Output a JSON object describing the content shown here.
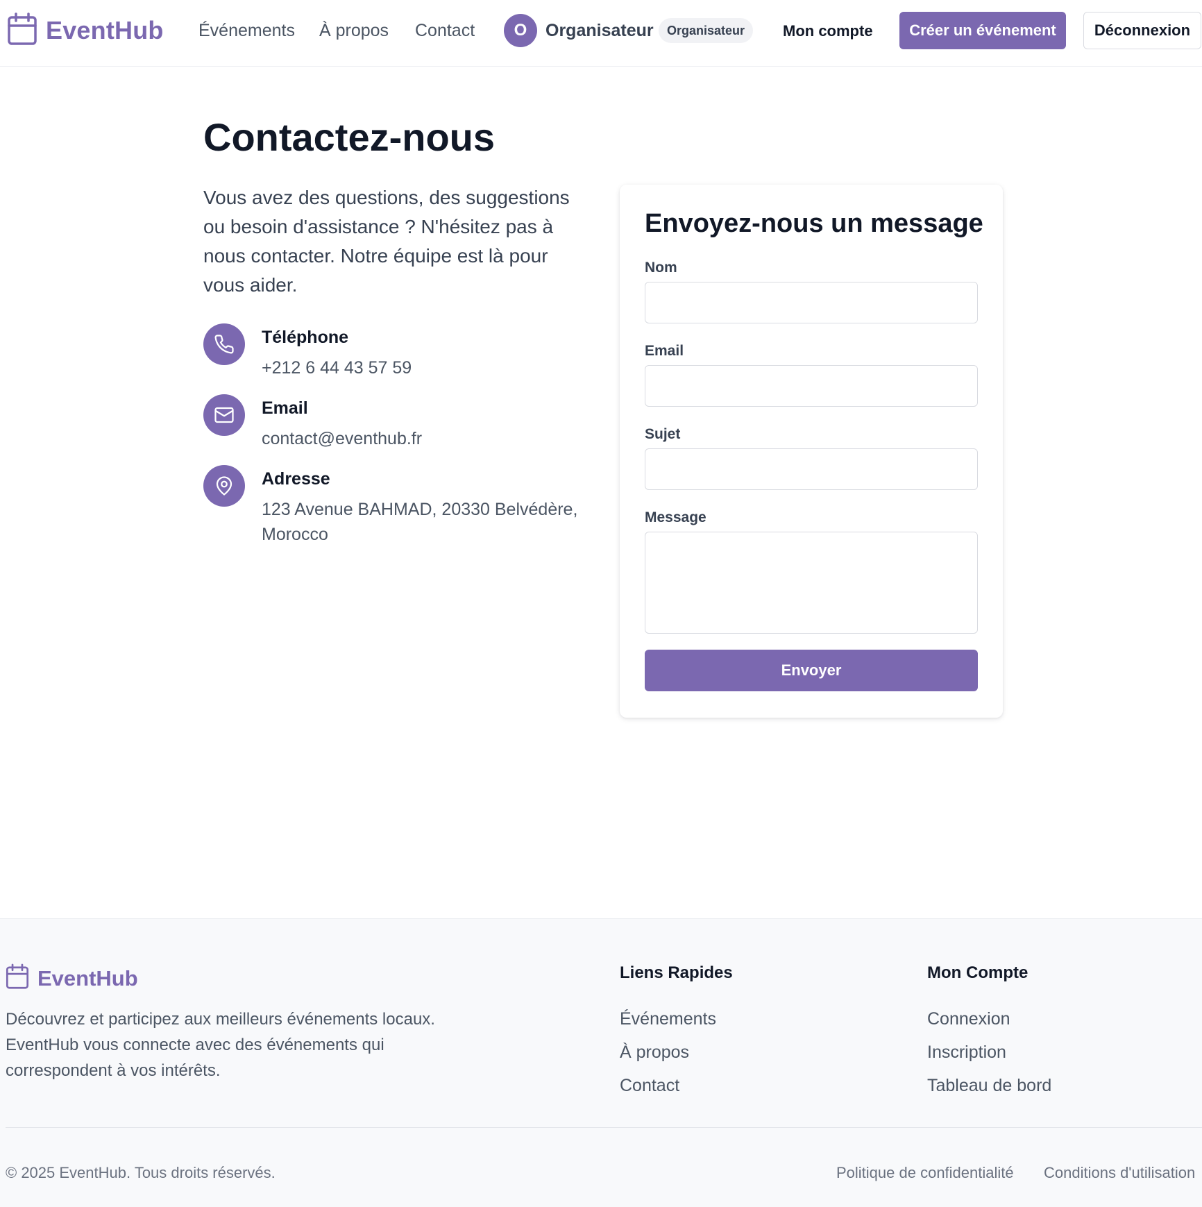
{
  "header": {
    "brand": "EventHub",
    "nav": [
      "Événements",
      "À propos",
      "Contact"
    ],
    "user": {
      "initial": "O",
      "name": "Organisateur",
      "role": "Organisateur"
    },
    "account_label": "Mon compte",
    "create_label": "Créer un événement",
    "logout_label": "Déconnexion"
  },
  "main": {
    "title": "Contactez-nous",
    "intro": "Vous avez des questions, des suggestions ou besoin d'assistance ? N'hésitez pas à nous contacter. Notre équipe est là pour vous aider.",
    "contacts": [
      {
        "icon": "phone-icon",
        "label": "Téléphone",
        "value": "+212 6 44 43 57 59"
      },
      {
        "icon": "mail-icon",
        "label": "Email",
        "value": "contact@eventhub.fr"
      },
      {
        "icon": "map-pin-icon",
        "label": "Adresse",
        "value": "123 Avenue BAHMAD, 20330 Belvédère, Morocco"
      }
    ]
  },
  "form": {
    "title": "Envoyez-nous un message",
    "fields": [
      {
        "label": "Nom",
        "value": "",
        "placeholder": ""
      },
      {
        "label": "Email",
        "value": "",
        "placeholder": ""
      },
      {
        "label": "Sujet",
        "value": "",
        "placeholder": ""
      },
      {
        "label": "Message",
        "value": "",
        "placeholder": ""
      }
    ],
    "submit_label": "Envoyer"
  },
  "footer": {
    "brand": "EventHub",
    "description": "Découvrez et participez aux meilleurs événements locaux. EventHub vous connecte avec des événements qui correspondent à vos intérêts.",
    "quick_links": {
      "title": "Liens Rapides",
      "items": [
        "Événements",
        "À propos",
        "Contact"
      ]
    },
    "account_links": {
      "title": "Mon Compte",
      "items": [
        "Connexion",
        "Inscription",
        "Tableau de bord"
      ]
    },
    "copyright": "© 2025 EventHub. Tous droits réservés.",
    "legal": [
      "Politique de confidentialité",
      "Conditions d'utilisation"
    ]
  },
  "colors": {
    "accent": "#7b68b0",
    "text_primary": "#111827",
    "text_secondary": "#4b5563",
    "footer_bg": "#f8f9fb",
    "border": "#d9dbe1"
  }
}
